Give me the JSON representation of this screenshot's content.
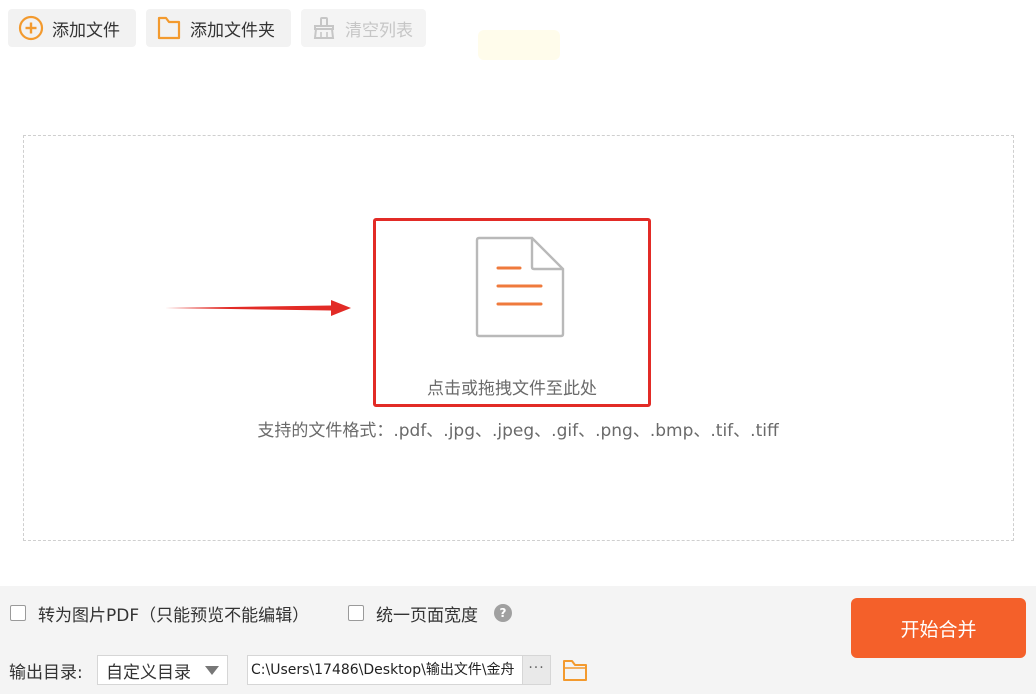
{
  "toolbar": {
    "add_file": "添加文件",
    "add_folder": "添加文件夹",
    "clear_list": "清空列表"
  },
  "drop_zone": {
    "hint": "点击或拖拽文件至此处",
    "formats": "支持的文件格式：.pdf、.jpg、.jpeg、.gif、.png、.bmp、.tif、.tiff"
  },
  "options": {
    "image_pdf_label": "转为图片PDF（只能预览不能编辑）",
    "image_pdf_checked": false,
    "unify_width_label": "统一页面宽度",
    "unify_width_checked": false,
    "help_glyph": "?"
  },
  "output": {
    "label": "输出目录:",
    "dir_mode": "自定义目录",
    "path": "C:\\Users\\17486\\Desktop\\输出文件\\金舟",
    "more": "···"
  },
  "start_button": "开始合并",
  "colors": {
    "accent": "#f4602a",
    "icon_orange": "#f39a2e",
    "highlight": "#e22b26",
    "disabled": "#c6c6c6"
  },
  "icons": {
    "add_file": "plus-circle-icon",
    "add_folder": "folder-icon",
    "clear_list": "broom-icon",
    "drop": "document-icon",
    "browse": "folder-icon",
    "help": "question-icon"
  }
}
